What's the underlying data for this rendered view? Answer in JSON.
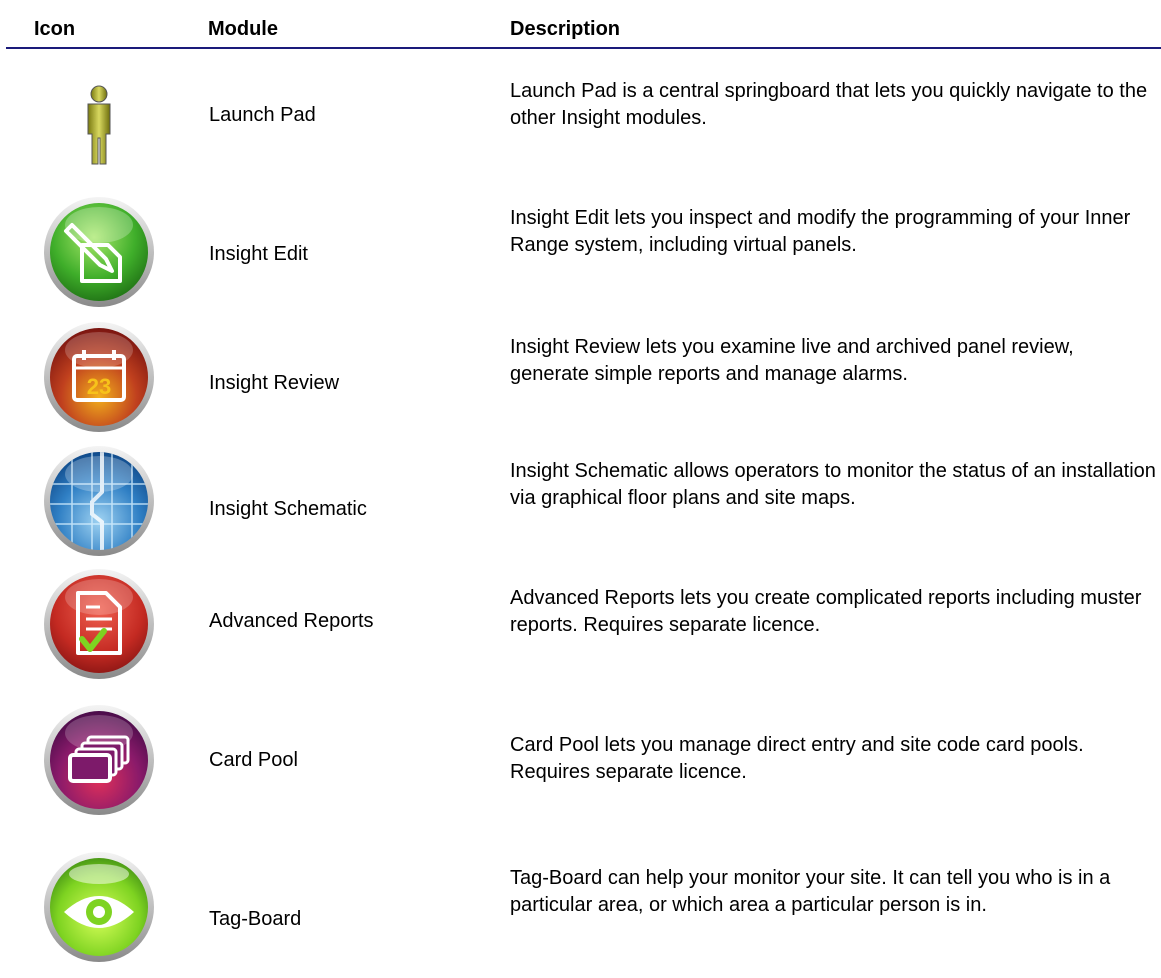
{
  "header": {
    "icon": "Icon",
    "module": "Module",
    "description": "Description"
  },
  "rows": [
    {
      "icon": "person-icon",
      "module": "Launch Pad",
      "description": "Launch Pad is a central springboard that lets you quickly navigate to the other Insight modules."
    },
    {
      "icon": "edit-pencil-icon",
      "module": "Insight Edit",
      "description": "Insight Edit lets you inspect and modify the programming of your Inner Range system, including virtual panels."
    },
    {
      "icon": "calendar-icon",
      "module": "Insight Review",
      "calendar_day": "23",
      "description": "Insight Review lets you examine live and archived panel review, generate simple reports and manage alarms."
    },
    {
      "icon": "floor-plan-icon",
      "module": "Insight Schematic",
      "description": "Insight Schematic allows operators to monitor the status of an installation via graphical floor plans and site maps."
    },
    {
      "icon": "report-check-icon",
      "module": "Advanced Reports",
      "description": "Advanced Reports lets you create complicated reports including muster reports. Requires separate licence."
    },
    {
      "icon": "card-stack-icon",
      "module": "Card Pool",
      "description": "Card Pool lets you manage direct entry and site code card pools. Requires separate licence."
    },
    {
      "icon": "eye-icon",
      "module": "Tag-Board",
      "description": "Tag-Board can help your monitor your site.  It can tell you who is in a particular area, or which area a particular person is in."
    }
  ],
  "colors": {
    "rule": "#1a1a7a",
    "edit": "#3fae2a",
    "review": "#b8261c",
    "schematic": "#2f7fc4",
    "reports": "#c42a22",
    "cardpool": "#7d1a6a",
    "tagboard": "#7ed321"
  }
}
